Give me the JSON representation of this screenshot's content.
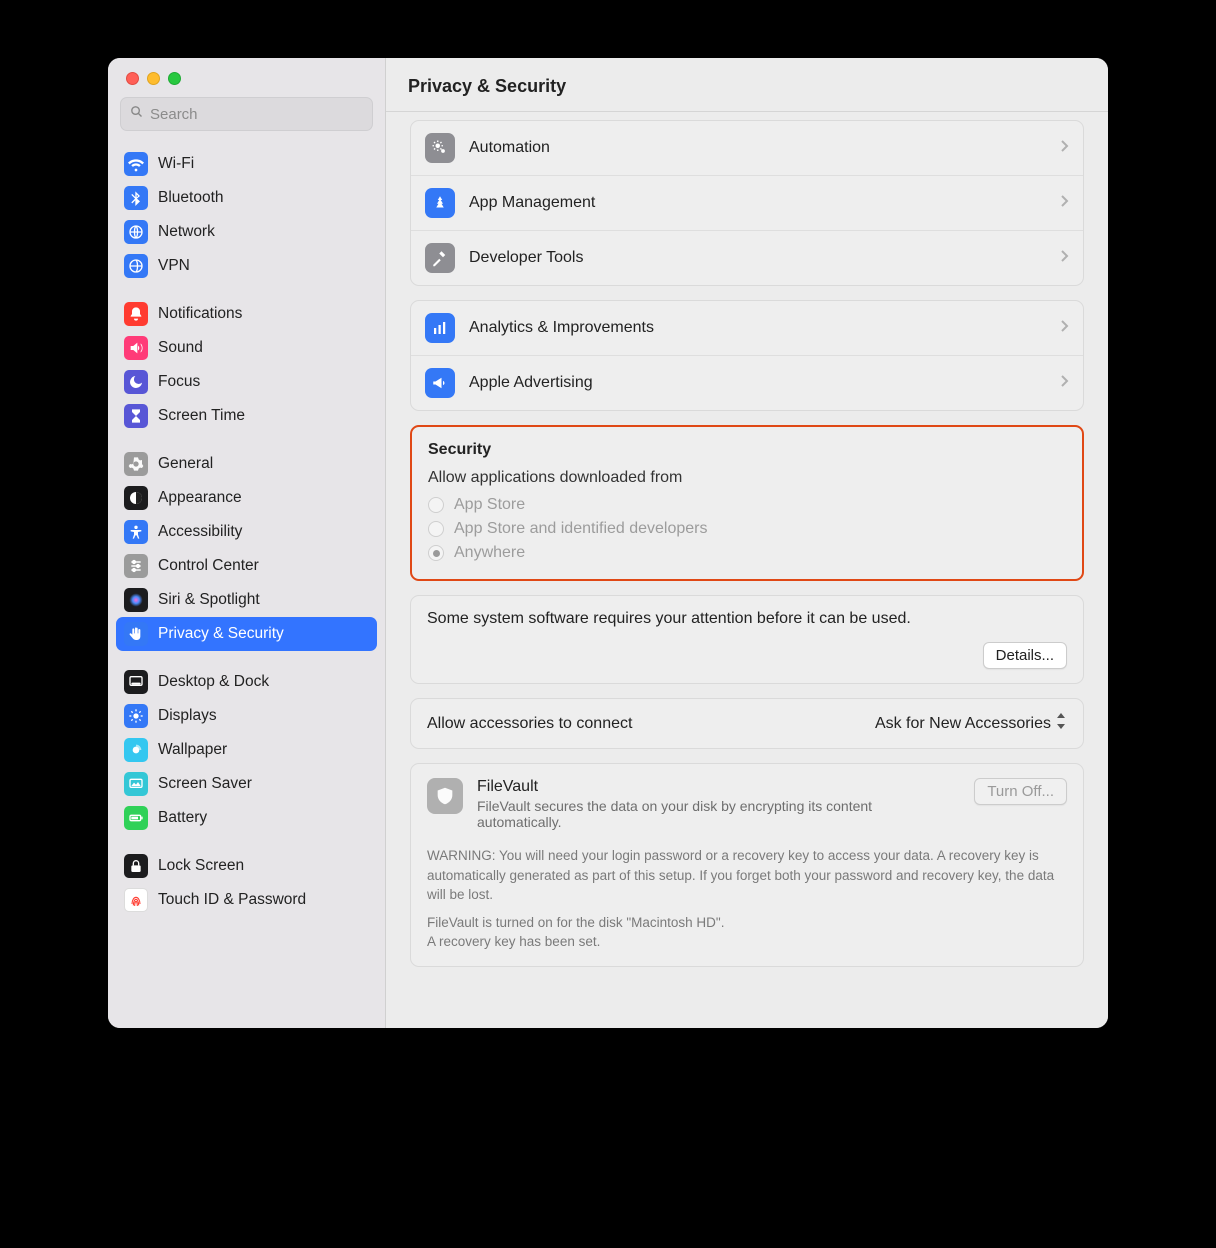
{
  "window": {
    "title": "Privacy & Security"
  },
  "search": {
    "placeholder": "Search"
  },
  "sidebar": {
    "groups": [
      [
        {
          "label": "Wi-Fi",
          "icon": "wifi",
          "bg": "#3478f6"
        },
        {
          "label": "Bluetooth",
          "icon": "bluetooth",
          "bg": "#3478f6"
        },
        {
          "label": "Network",
          "icon": "network",
          "bg": "#3478f6"
        },
        {
          "label": "VPN",
          "icon": "vpn",
          "bg": "#3478f6"
        }
      ],
      [
        {
          "label": "Notifications",
          "icon": "bell",
          "bg": "#ff3b30"
        },
        {
          "label": "Sound",
          "icon": "sound",
          "bg": "#ff3b78"
        },
        {
          "label": "Focus",
          "icon": "moon",
          "bg": "#5856d6"
        },
        {
          "label": "Screen Time",
          "icon": "hourglass",
          "bg": "#5856d6"
        }
      ],
      [
        {
          "label": "General",
          "icon": "gear",
          "bg": "#9b9b9b"
        },
        {
          "label": "Appearance",
          "icon": "appearance",
          "bg": "#1c1c1e"
        },
        {
          "label": "Accessibility",
          "icon": "access",
          "bg": "#3478f6"
        },
        {
          "label": "Control Center",
          "icon": "sliders",
          "bg": "#9b9b9b"
        },
        {
          "label": "Siri & Spotlight",
          "icon": "siri",
          "bg": "#1c1c1e"
        },
        {
          "label": "Privacy & Security",
          "icon": "hand",
          "bg": "#3478f6",
          "selected": true
        }
      ],
      [
        {
          "label": "Desktop & Dock",
          "icon": "dock",
          "bg": "#1c1c1e"
        },
        {
          "label": "Displays",
          "icon": "display",
          "bg": "#3478f6"
        },
        {
          "label": "Wallpaper",
          "icon": "wallpaper",
          "bg": "#34c7f0"
        },
        {
          "label": "Screen Saver",
          "icon": "screensaver",
          "bg": "#34c7d6"
        },
        {
          "label": "Battery",
          "icon": "battery",
          "bg": "#30d158"
        }
      ],
      [
        {
          "label": "Lock Screen",
          "icon": "lock",
          "bg": "#1c1c1e"
        },
        {
          "label": "Touch ID & Password",
          "icon": "finger",
          "bg": "#ffffff",
          "fg": "#ff3b30",
          "border": "#dcdcdc"
        }
      ]
    ]
  },
  "privacy_rows": {
    "group1": [
      {
        "label": "Automation",
        "icon": "gears",
        "bg": "#8e8e93"
      },
      {
        "label": "App Management",
        "icon": "appmgmt",
        "bg": "#3478f6"
      },
      {
        "label": "Developer Tools",
        "icon": "hammer",
        "bg": "#8e8e93"
      }
    ],
    "group2": [
      {
        "label": "Analytics & Improvements",
        "icon": "chart",
        "bg": "#3478f6"
      },
      {
        "label": "Apple Advertising",
        "icon": "megaphone",
        "bg": "#3478f6"
      }
    ]
  },
  "security": {
    "heading": "Security",
    "allow_label": "Allow applications downloaded from",
    "options": [
      {
        "label": "App Store",
        "selected": false
      },
      {
        "label": "App Store and identified developers",
        "selected": false
      },
      {
        "label": "Anywhere",
        "selected": true
      }
    ]
  },
  "attention": {
    "text": "Some system software requires your attention before it can be used.",
    "button": "Details..."
  },
  "accessories": {
    "label": "Allow accessories to connect",
    "value": "Ask for New Accessories"
  },
  "filevault": {
    "title": "FileVault",
    "desc": "FileVault secures the data on your disk by encrypting its content automatically.",
    "button": "Turn Off...",
    "warn1": "WARNING: You will need your login password or a recovery key to access your data. A recovery key is automatically generated as part of this setup. If you forget both your password and recovery key, the data will be lost.",
    "warn2a": "FileVault is turned on for the disk \"Macintosh HD\".",
    "warn2b": "A recovery key has been set."
  }
}
